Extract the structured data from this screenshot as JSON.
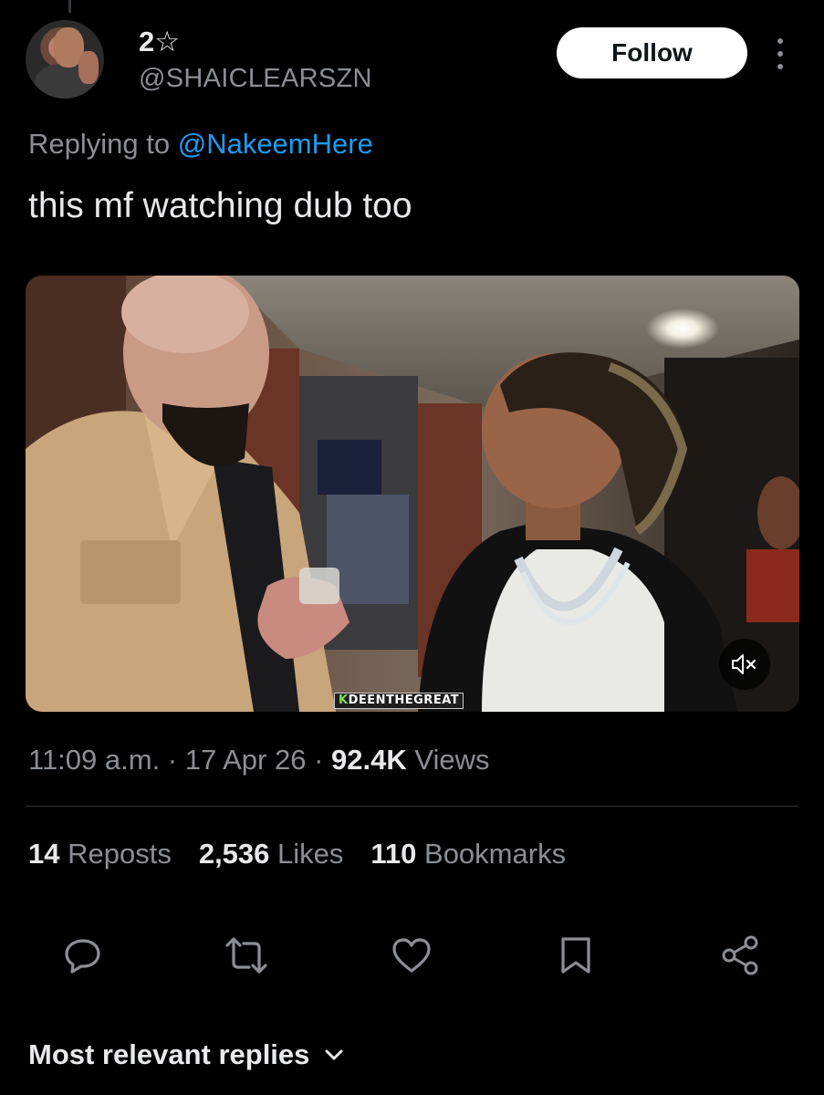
{
  "author": {
    "display_name": "2☆",
    "handle": "@SHAICLEARSZN"
  },
  "follow_label": "Follow",
  "replying": {
    "prefix": "Replying to ",
    "mention": "@NakeemHere"
  },
  "tweet_text": "this mf watching dub too",
  "media": {
    "watermark_prefix": "K",
    "watermark_rest": "DEENTHEGREAT",
    "muted": true
  },
  "meta": {
    "time": "11:09 a.m.",
    "sep1": " · ",
    "date": "17 Apr 26",
    "sep2": " · ",
    "views_count": "92.4K",
    "views_label": " Views"
  },
  "stats": [
    {
      "count": "14",
      "label": " Reposts"
    },
    {
      "count": "2,536",
      "label": " Likes"
    },
    {
      "count": "110",
      "label": " Bookmarks"
    }
  ],
  "actions": [
    "reply-icon",
    "repost-icon",
    "like-icon",
    "bookmark-icon",
    "share-icon"
  ],
  "replies_sort_label": "Most relevant replies",
  "colors": {
    "background": "#000000",
    "text": "#e7e9ea",
    "secondary": "#8b8f94",
    "accent": "#1d9bf0",
    "divider": "#2f3336"
  }
}
